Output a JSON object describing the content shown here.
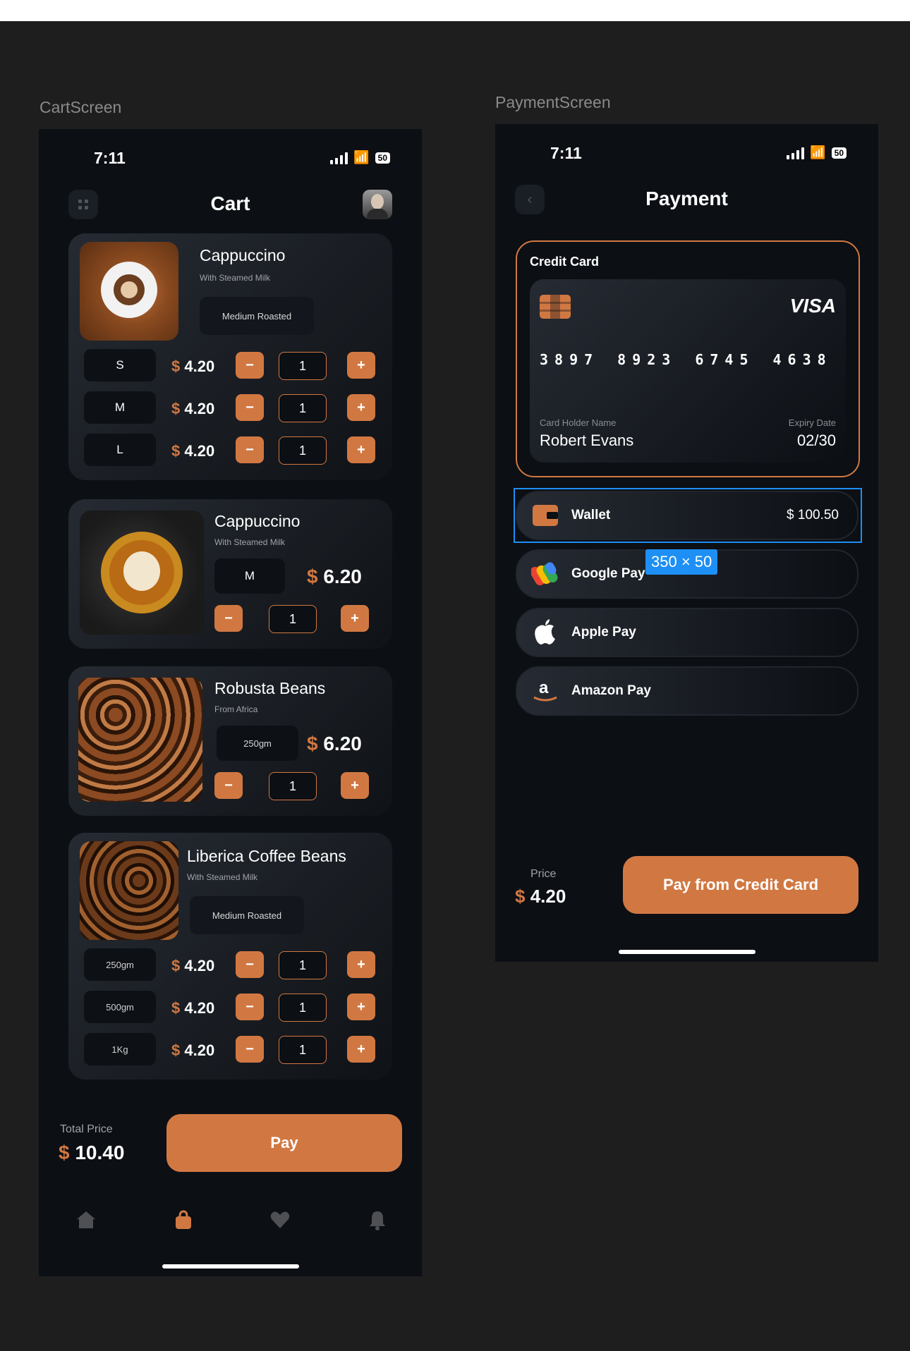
{
  "frames": {
    "cart_label": "CartScreen",
    "payment_label": "PaymentScreen"
  },
  "colors": {
    "accent": "#D17842",
    "background": "#0C0F14",
    "canvas": "#1E1E1E",
    "selection": "#1D8FF5"
  },
  "cart": {
    "status_time": "7:11",
    "battery": "50",
    "title": "Cart",
    "icons": [
      "grid-icon",
      "avatar"
    ],
    "items": [
      {
        "name": "Cappuccino",
        "subtitle": "With Steamed Milk",
        "roast": "Medium Roasted",
        "sizes": [
          {
            "size": "S",
            "currency": "$",
            "price": "4.20",
            "qty": "1"
          },
          {
            "size": "M",
            "currency": "$",
            "price": "4.20",
            "qty": "1"
          },
          {
            "size": "L",
            "currency": "$",
            "price": "4.20",
            "qty": "1"
          }
        ]
      },
      {
        "name": "Cappuccino",
        "subtitle": "With Steamed Milk",
        "size": "M",
        "currency": "$",
        "price": "6.20",
        "qty": "1"
      },
      {
        "name": "Robusta Beans",
        "subtitle": "From Africa",
        "size": "250gm",
        "currency": "$",
        "price": "6.20",
        "qty": "1"
      },
      {
        "name": "Liberica Coffee Beans",
        "subtitle": "With Steamed Milk",
        "roast": "Medium Roasted",
        "sizes": [
          {
            "size": "250gm",
            "currency": "$",
            "price": "4.20",
            "qty": "1"
          },
          {
            "size": "500gm",
            "currency": "$",
            "price": "4.20",
            "qty": "1"
          },
          {
            "size": "1Kg",
            "currency": "$",
            "price": "4.20",
            "qty": "1"
          }
        ]
      }
    ],
    "total_label": "Total Price",
    "total_currency": "$",
    "total_value": "10.40",
    "pay_label": "Pay",
    "nav": [
      "home-icon",
      "bag-icon",
      "heart-icon",
      "bell-icon"
    ],
    "nav_active": "bag-icon"
  },
  "payment": {
    "status_time": "7:11",
    "battery": "50",
    "title": "Payment",
    "credit_card": {
      "section_label": "Credit Card",
      "brand": "VISA",
      "number": [
        "3897",
        "8923",
        "6745",
        "4638"
      ],
      "holder_label": "Card Holder Name",
      "holder_name": "Robert Evans",
      "expiry_label": "Expiry Date",
      "expiry": "02/30"
    },
    "options": [
      {
        "label": "Wallet",
        "amount": "$ 100.50",
        "icon": "wallet-icon"
      },
      {
        "label": "Google Pay",
        "icon": "google-pay-icon"
      },
      {
        "label": "Apple Pay",
        "icon": "apple-icon"
      },
      {
        "label": "Amazon Pay",
        "icon": "amazon-icon"
      }
    ],
    "selection_badge": "350 × 50",
    "price_label": "Price",
    "price_currency": "$",
    "price_value": "4.20",
    "pay_label": "Pay from Credit Card"
  }
}
